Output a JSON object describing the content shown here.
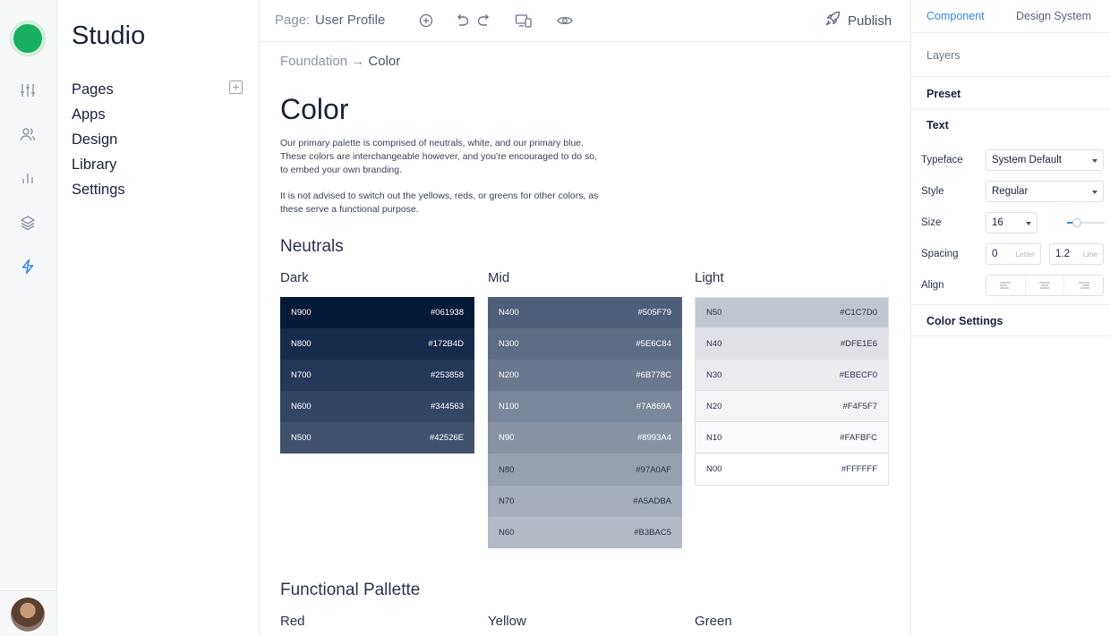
{
  "app": {
    "title": "Studio"
  },
  "rail": {
    "icons": [
      "sliders-icon",
      "users-icon",
      "bar-chart-icon",
      "layers-icon",
      "lightning-icon"
    ],
    "active_color": "#3a86e8",
    "brand_color": "#18b060"
  },
  "nav": {
    "items": [
      {
        "label": "Pages"
      },
      {
        "label": "Apps"
      },
      {
        "label": "Design"
      },
      {
        "label": "Library"
      },
      {
        "label": "Settings"
      }
    ]
  },
  "topbar": {
    "page_label": "Page:",
    "page_name": "User Profile",
    "publish_label": "Publish"
  },
  "main": {
    "breadcrumb": {
      "parent": "Foundation",
      "separator": "→",
      "current": "Color"
    },
    "title": "Color",
    "intro_1": "Our primary palette is comprised of neutrals, white, and our primary blue. These colors are interchangeable however, and you're encouraged to do so, to embed your own branding.",
    "intro_2": "It is not advised to switch out the yellows, reds, or greens for other colors, as these serve a functional purpose.",
    "neutrals_heading": "Neutrals",
    "columns": [
      {
        "title": "Dark",
        "swatches": [
          {
            "name": "N900",
            "hex": "#061938"
          },
          {
            "name": "N800",
            "hex": "#172B4D"
          },
          {
            "name": "N700",
            "hex": "#253858"
          },
          {
            "name": "N600",
            "hex": "#344563"
          },
          {
            "name": "N500",
            "hex": "#42526E"
          }
        ]
      },
      {
        "title": "Mid",
        "swatches": [
          {
            "name": "N400",
            "hex": "#505F79"
          },
          {
            "name": "N300",
            "hex": "#5E6C84"
          },
          {
            "name": "N200",
            "hex": "#6B778C"
          },
          {
            "name": "N100",
            "hex": "#7A869A"
          },
          {
            "name": "N90",
            "hex": "#8993A4"
          },
          {
            "name": "N80",
            "hex": "#97A0AF"
          },
          {
            "name": "N70",
            "hex": "#A5ADBA"
          },
          {
            "name": "N60",
            "hex": "#B3BAC5"
          }
        ]
      },
      {
        "title": "Light",
        "swatches": [
          {
            "name": "N50",
            "hex": "#C1C7D0"
          },
          {
            "name": "N40",
            "hex": "#DFE1E6"
          },
          {
            "name": "N30",
            "hex": "#EBECF0"
          },
          {
            "name": "N20",
            "hex": "#F4F5F7"
          },
          {
            "name": "N10",
            "hex": "#FAFBFC"
          },
          {
            "name": "N00",
            "hex": "#FFFFFF"
          }
        ]
      }
    ],
    "functional_heading": "Functional Pallette",
    "functional_columns": [
      {
        "title": "Red"
      },
      {
        "title": "Yellow"
      },
      {
        "title": "Green"
      }
    ]
  },
  "panel": {
    "tabs": [
      {
        "label": "Component",
        "active": true
      },
      {
        "label": "Design System",
        "active": false
      }
    ],
    "sections": {
      "layers": "Layers",
      "preset": "Preset",
      "text": "Text",
      "color_settings": "Color Settings"
    },
    "typeface": {
      "label": "Typeface",
      "value": "System Default"
    },
    "style": {
      "label": "Style",
      "value": "Regular"
    },
    "size": {
      "label": "Size",
      "value": "16",
      "slider_fraction": 0.25
    },
    "spacing": {
      "label": "Spacing",
      "letter_value": "0",
      "letter_hint": "Letter",
      "line_value": "1.2",
      "line_hint": "Line"
    },
    "align": {
      "label": "Align",
      "options": [
        "align-left-icon",
        "align-center-icon",
        "align-right-icon"
      ]
    },
    "accent_color": "#3a86e8"
  }
}
